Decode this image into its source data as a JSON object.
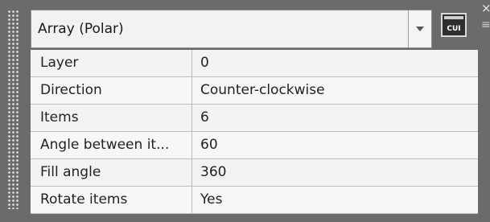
{
  "panel": {
    "object_type": "Array (Polar)",
    "close_glyph": "×",
    "menu_glyph": "≡",
    "cui_button_label": "CUI"
  },
  "properties": [
    {
      "label": "Layer",
      "value": "0"
    },
    {
      "label": "Direction",
      "value": "Counter-clockwise"
    },
    {
      "label": "Items",
      "value": "6"
    },
    {
      "label": "Angle between it...",
      "value": "60"
    },
    {
      "label": "Fill angle",
      "value": "360"
    },
    {
      "label": "Rotate items",
      "value": "Yes"
    }
  ],
  "icons": {
    "grip": "grip-dots-icon",
    "dropdown_arrow": "chevron-down-icon",
    "cui": "cui-monitor-icon",
    "close": "close-icon",
    "menu": "menu-icon"
  }
}
